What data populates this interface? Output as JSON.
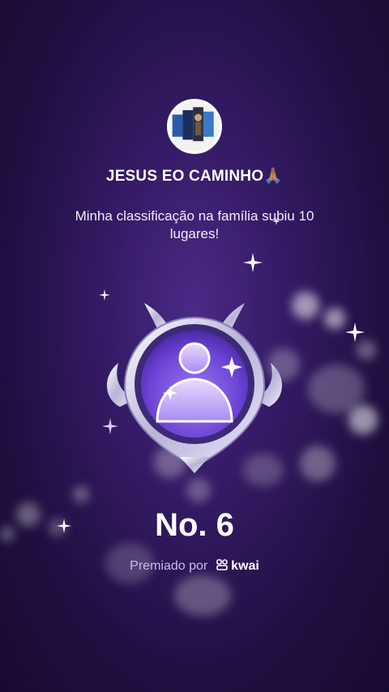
{
  "profile": {
    "name": "JESUS EO CAMINHO🙏🏽",
    "avatar_icon": "profile-avatar-image"
  },
  "message": "Minha classificação na família subiu 10 lugares!",
  "badge": {
    "icon": "family-rank-badge-icon"
  },
  "rank_label": "No. 6",
  "award": {
    "prefix": "Premiado por",
    "brand": "kwai",
    "brand_icon": "kwai-logo-icon"
  },
  "colors": {
    "background": "#331a63",
    "badge_core": "#7b4fe0",
    "text": "#ffffff"
  }
}
